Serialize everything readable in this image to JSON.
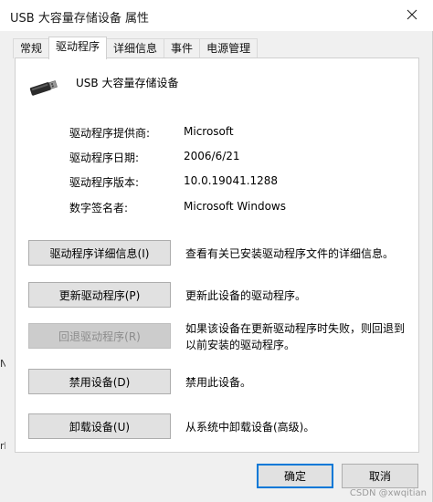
{
  "window": {
    "title": "USB 大容量存储设备 属性"
  },
  "tabs": [
    {
      "label": "常规",
      "active": false
    },
    {
      "label": "驱动程序",
      "active": true
    },
    {
      "label": "详细信息",
      "active": false
    },
    {
      "label": "事件",
      "active": false
    },
    {
      "label": "电源管理",
      "active": false
    }
  ],
  "device": {
    "name": "USB 大容量存储设备",
    "icon": "usb-drive-icon"
  },
  "driver_info": [
    {
      "label": "驱动程序提供商:",
      "value": "Microsoft"
    },
    {
      "label": "驱动程序日期:",
      "value": "2006/6/21"
    },
    {
      "label": "驱动程序版本:",
      "value": "10.0.19041.1288"
    },
    {
      "label": "数字签名者:",
      "value": "Microsoft Windows"
    }
  ],
  "actions": [
    {
      "button": "驱动程序详细信息(I)",
      "description": "查看有关已安装驱动程序文件的详细信息。",
      "enabled": true
    },
    {
      "button": "更新驱动程序(P)",
      "description": "更新此设备的驱动程序。",
      "enabled": true
    },
    {
      "button": "回退驱动程序(R)",
      "description": "如果该设备在更新驱动程序时失败，则回退到以前安装的驱动程序。",
      "enabled": false
    },
    {
      "button": "禁用设备(D)",
      "description": "禁用此设备。",
      "enabled": true
    },
    {
      "button": "卸载设备(U)",
      "description": "从系统中卸载设备(高级)。",
      "enabled": true
    }
  ],
  "footer": {
    "ok_label": "确定",
    "cancel_label": "取消"
  },
  "watermark": "CSDN @xwqitian",
  "edge_glyphs": [
    "N",
    "rk"
  ],
  "colors": {
    "accent": "#0078d7",
    "dialog_bg": "#f0f0f0",
    "button_bg": "#e1e1e1",
    "disabled_text": "#8c8c8c"
  }
}
